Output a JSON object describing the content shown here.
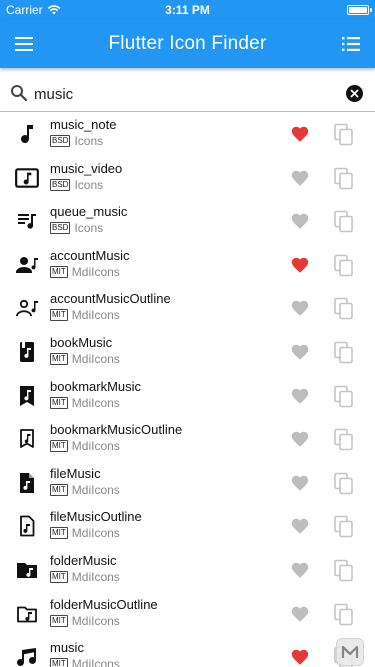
{
  "status_bar": {
    "carrier": "Carrier",
    "time": "3:11 PM"
  },
  "app_bar": {
    "title": "Flutter Icon Finder",
    "menu_icon": "hamburger-menu-icon",
    "view_icon": "list-view-icon"
  },
  "search": {
    "value": "music",
    "placeholder": ""
  },
  "colors": {
    "primary": "#2196f3",
    "favorite_on": "#e53935",
    "favorite_off": "#bdbdbd",
    "copy": "#c4c4c4"
  },
  "results": [
    {
      "name": "music_note",
      "license": "BSD",
      "library": "Icons",
      "favorite": true,
      "icon": "music-note-icon"
    },
    {
      "name": "music_video",
      "license": "BSD",
      "library": "Icons",
      "favorite": false,
      "icon": "music-video-icon"
    },
    {
      "name": "queue_music",
      "license": "BSD",
      "library": "Icons",
      "favorite": false,
      "icon": "queue-music-icon"
    },
    {
      "name": "accountMusic",
      "license": "MIT",
      "library": "MdiIcons",
      "favorite": true,
      "icon": "account-music-icon"
    },
    {
      "name": "accountMusicOutline",
      "license": "MIT",
      "library": "MdiIcons",
      "favorite": false,
      "icon": "account-music-outline-icon"
    },
    {
      "name": "bookMusic",
      "license": "MIT",
      "library": "MdiIcons",
      "favorite": false,
      "icon": "book-music-icon"
    },
    {
      "name": "bookmarkMusic",
      "license": "MIT",
      "library": "MdiIcons",
      "favorite": false,
      "icon": "bookmark-music-icon"
    },
    {
      "name": "bookmarkMusicOutline",
      "license": "MIT",
      "library": "MdiIcons",
      "favorite": false,
      "icon": "bookmark-music-outline-icon"
    },
    {
      "name": "fileMusic",
      "license": "MIT",
      "library": "MdiIcons",
      "favorite": false,
      "icon": "file-music-icon"
    },
    {
      "name": "fileMusicOutline",
      "license": "MIT",
      "library": "MdiIcons",
      "favorite": false,
      "icon": "file-music-outline-icon"
    },
    {
      "name": "folderMusic",
      "license": "MIT",
      "library": "MdiIcons",
      "favorite": false,
      "icon": "folder-music-icon"
    },
    {
      "name": "folderMusicOutline",
      "license": "MIT",
      "library": "MdiIcons",
      "favorite": false,
      "icon": "folder-music-outline-icon"
    },
    {
      "name": "music",
      "license": "MIT",
      "library": "MdiIcons",
      "favorite": true,
      "icon": "music-icon"
    }
  ]
}
